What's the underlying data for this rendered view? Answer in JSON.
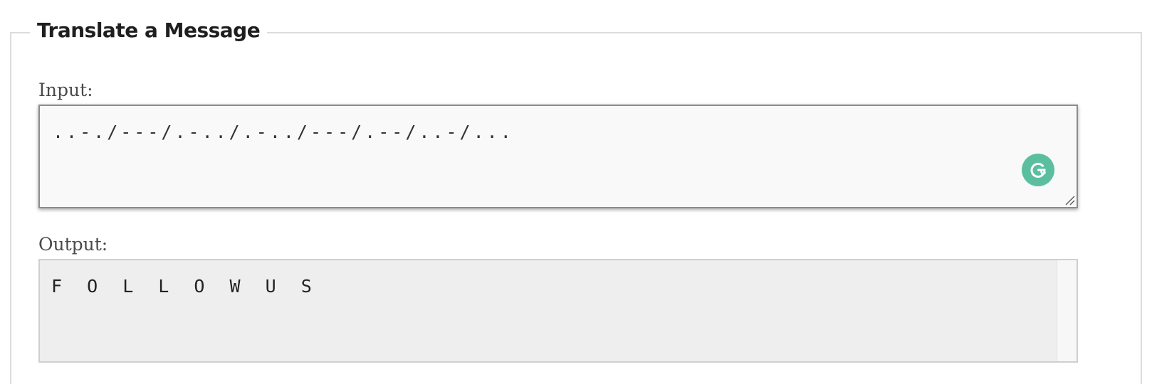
{
  "section": {
    "title": "Translate a Message"
  },
  "input": {
    "label": "Input:",
    "value": "..-./---/.-../.-../---/.--/..-/..."
  },
  "output": {
    "label": "Output:",
    "value": "F O L L O W U S"
  },
  "icons": {
    "grammarly": "grammarly-icon",
    "resize": "resize-handle-icon"
  },
  "colors": {
    "grammarly_green": "#5bbf9f",
    "input_bg": "#f9f9f9",
    "output_bg": "#eeeeee"
  }
}
